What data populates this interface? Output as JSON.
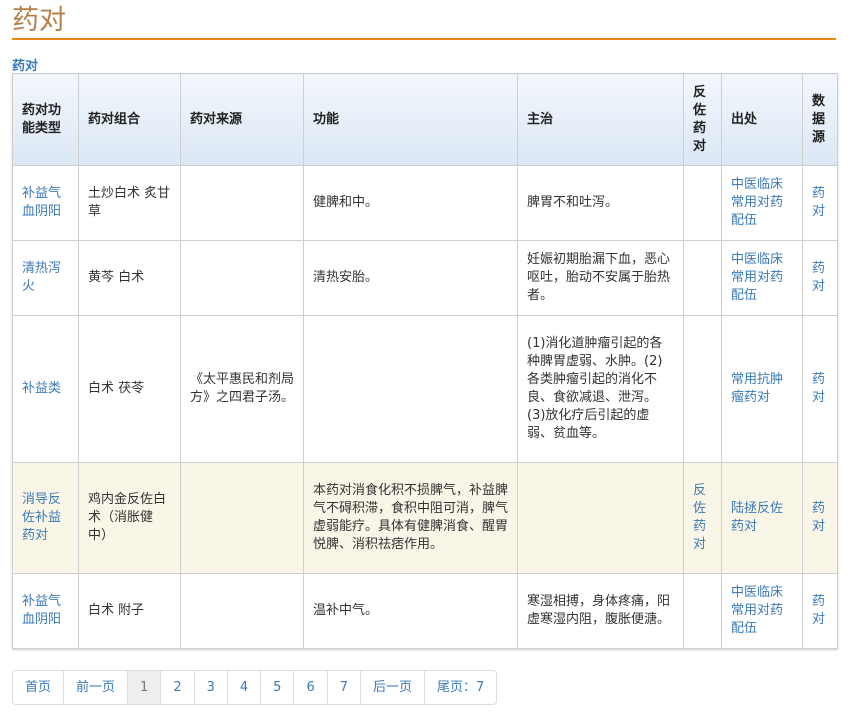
{
  "title": "药对",
  "subtitle": "药对",
  "headers": [
    "药对功能类型",
    "药对组合",
    "药对来源",
    "功能",
    "主治",
    "反佐药对",
    "出处",
    "数据源"
  ],
  "rows": [
    {
      "type": "补益气血阴阳",
      "combo": "土炒白术 炙甘草",
      "source": "",
      "function": "健脾和中。",
      "indication": "脾胃不和吐泻。",
      "reverse": "",
      "origin": "中医临床常用对药配伍",
      "ds": "药对"
    },
    {
      "type": "清热泻火",
      "combo": "黄芩 白术",
      "source": "",
      "function": "清热安胎。",
      "indication": "妊娠初期胎漏下血，恶心呕吐，胎动不安属于胎热者。",
      "reverse": "",
      "origin": "中医临床常用对药配伍",
      "ds": "药对"
    },
    {
      "type": "补益类",
      "combo": "白术 茯苓",
      "source": "《太平惠民和剂局方》之四君子汤。",
      "function": "",
      "indication": "(1)消化道肿瘤引起的各种脾胃虚弱、水肿。(2)各类肿瘤引起的消化不良、食欲减退、泄泻。(3)放化疗后引起的虚弱、贫血等。",
      "reverse": "",
      "origin": "常用抗肿瘤药对",
      "ds": "药对"
    },
    {
      "type": "消导反佐补益药对",
      "combo": "鸡内金反佐白术（消胀健中）",
      "source": "",
      "function": "本药对消食化积不损脾气，补益脾气不碍积滞，食积中阻可消，脾气虚弱能疗。具体有健脾消食、醒胃悦脾、消积祛痞作用。",
      "indication": "",
      "reverse": "反佐药对",
      "origin": "陆拯反佐药对",
      "ds": "药对"
    },
    {
      "type": "补益气血阴阳",
      "combo": "白术 附子",
      "source": "",
      "function": "温补中气。",
      "indication": "寒湿相搏，身体疼痛，阳虚寒湿内阻，腹胀便溏。",
      "reverse": "",
      "origin": "中医临床常用对药配伍",
      "ds": "药对"
    }
  ],
  "pagination": {
    "first": "首页",
    "prev": "前一页",
    "pages": [
      "1",
      "2",
      "3",
      "4",
      "5",
      "6",
      "7"
    ],
    "current": "1",
    "next": "后一页",
    "last": "尾页：7"
  }
}
